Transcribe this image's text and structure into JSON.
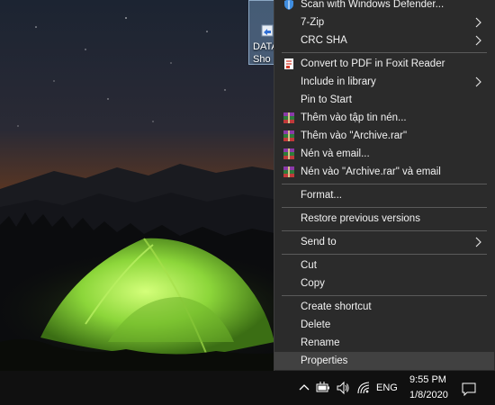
{
  "desktop": {
    "icon_label": "DATA\nSho",
    "icon_name": "shortcut-file-icon"
  },
  "context_menu": {
    "items": [
      {
        "label": "Scan with Windows Defender...",
        "icon": "defender-shield-icon",
        "submenu": false
      },
      {
        "label": "7-Zip",
        "icon": "",
        "submenu": true
      },
      {
        "label": "CRC SHA",
        "icon": "",
        "submenu": true
      },
      {
        "label": "Convert to PDF in Foxit Reader",
        "icon": "foxit-pdf-icon",
        "submenu": false
      },
      {
        "label": "Include in library",
        "icon": "",
        "submenu": true
      },
      {
        "label": "Pin to Start",
        "icon": "",
        "submenu": false
      },
      {
        "label": "Thêm vào tập tin nén...",
        "icon": "winrar-icon",
        "submenu": false
      },
      {
        "label": "Thêm vào \"Archive.rar\"",
        "icon": "winrar-icon",
        "submenu": false
      },
      {
        "label": "Nén và email...",
        "icon": "winrar-icon",
        "submenu": false
      },
      {
        "label": "Nén vào \"Archive.rar\" và email",
        "icon": "winrar-icon",
        "submenu": false
      },
      {
        "label": "Format...",
        "icon": "",
        "submenu": false
      },
      {
        "label": "Restore previous versions",
        "icon": "",
        "submenu": false
      },
      {
        "label": "Send to",
        "icon": "",
        "submenu": true
      },
      {
        "label": "Cut",
        "icon": "",
        "submenu": false
      },
      {
        "label": "Copy",
        "icon": "",
        "submenu": false
      },
      {
        "label": "Create shortcut",
        "icon": "",
        "submenu": false
      },
      {
        "label": "Delete",
        "icon": "",
        "submenu": false
      },
      {
        "label": "Rename",
        "icon": "",
        "submenu": false
      },
      {
        "label": "Properties",
        "icon": "",
        "submenu": false,
        "highlighted": true
      }
    ]
  },
  "taskbar": {
    "language": "ENG",
    "time": "9:55 PM",
    "date": "1/8/2020",
    "tray_icons": [
      "chevron-up-icon",
      "battery-icon",
      "volume-icon",
      "wifi-icon",
      "notification-icon"
    ]
  },
  "colors": {
    "menu_bg": "#2b2b2b",
    "menu_highlight": "#414141",
    "taskbar_bg": "#101010",
    "tent_green": "#8cd63a"
  }
}
